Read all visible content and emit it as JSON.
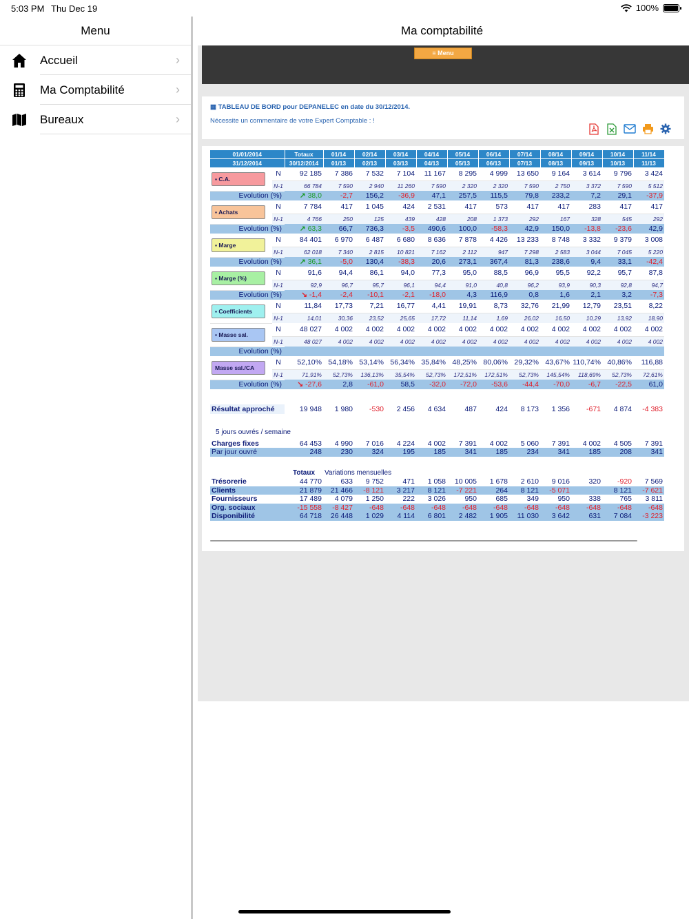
{
  "status": {
    "time": "5:03 PM",
    "date": "Thu Dec 19",
    "battery": "100%"
  },
  "sidebar": {
    "title": "Menu",
    "items": [
      {
        "label": "Accueil",
        "icon": "home-icon"
      },
      {
        "label": "Ma Comptabilité",
        "icon": "calculator-icon"
      },
      {
        "label": "Bureaux",
        "icon": "map-icon"
      }
    ]
  },
  "main": {
    "title": "Ma comptabilité",
    "menu_button": "≡ Menu",
    "heading": "TABLEAU DE BORD pour DEPANELEC en date du 30/12/2014.",
    "comment": "Nécessite un commentaire de votre Expert Comptable : !",
    "tools": [
      "pdf-icon",
      "excel-icon",
      "mail-icon",
      "print-icon",
      "settings-icon"
    ]
  },
  "table": {
    "head1": [
      "01/01/2014",
      "Totaux",
      "01/14",
      "02/14",
      "03/14",
      "04/14",
      "05/14",
      "06/14",
      "07/14",
      "08/14",
      "09/14",
      "10/14",
      "11/14"
    ],
    "head2": [
      "31/12/2014",
      "30/12/2014",
      "01/13",
      "02/13",
      "03/13",
      "04/13",
      "05/13",
      "06/13",
      "07/13",
      "08/13",
      "09/13",
      "10/13",
      "11/13"
    ],
    "blocks": [
      {
        "label": "C.A.",
        "color": "#f79a9e",
        "icon": "chart-line-icon",
        "n": [
          "92 185",
          "7 386",
          "7 532",
          "7 104",
          "11 167",
          "8 295",
          "4 999",
          "13 650",
          "9 164",
          "3 614",
          "9 796",
          "3 424"
        ],
        "n1": [
          "66 784",
          "7 590",
          "2 940",
          "11 260",
          "7 590",
          "2 320",
          "2 320",
          "7 590",
          "2 750",
          "3 372",
          "7 590",
          "5 512"
        ],
        "evo": [
          "38,0",
          "-2,7",
          "156,2",
          "-36,9",
          "47,1",
          "257,5",
          "115,5",
          "79,8",
          "233,2",
          "7,2",
          "29,1",
          "-37,9"
        ],
        "evo_dir": "up"
      },
      {
        "label": "Achats",
        "color": "#f8c49a",
        "icon": "briefcase-icon",
        "n": [
          "7 784",
          "417",
          "1 045",
          "424",
          "2 531",
          "417",
          "573",
          "417",
          "417",
          "283",
          "417",
          "417"
        ],
        "n1": [
          "4 766",
          "250",
          "125",
          "439",
          "428",
          "208",
          "1 373",
          "292",
          "167",
          "328",
          "545",
          "292"
        ],
        "evo": [
          "63,3",
          "66,7",
          "736,3",
          "-3,5",
          "490,6",
          "100,0",
          "-58,3",
          "42,9",
          "150,0",
          "-13,8",
          "-23,6",
          "42,9"
        ],
        "evo_dir": "up"
      },
      {
        "label": "Marge",
        "color": "#f1f29a",
        "icon": "area-chart-icon",
        "n": [
          "84 401",
          "6 970",
          "6 487",
          "6 680",
          "8 636",
          "7 878",
          "4 426",
          "13 233",
          "8 748",
          "3 332",
          "9 379",
          "3 008"
        ],
        "n1": [
          "62 018",
          "7 340",
          "2 815",
          "10 821",
          "7 162",
          "2 112",
          "947",
          "7 298",
          "2 583",
          "3 044",
          "7 045",
          "5 220"
        ],
        "evo": [
          "36,1",
          "-5,0",
          "130,4",
          "-38,3",
          "20,6",
          "273,1",
          "367,4",
          "81,3",
          "238,6",
          "9,4",
          "33,1",
          "-42,4"
        ],
        "evo_dir": "up"
      },
      {
        "label": "Marge (%)",
        "color": "#a8f0a3",
        "icon": "bar-chart-icon",
        "n": [
          "91,6",
          "94,4",
          "86,1",
          "94,0",
          "77,3",
          "95,0",
          "88,5",
          "96,9",
          "95,5",
          "92,2",
          "95,7",
          "87,8"
        ],
        "n1": [
          "92,9",
          "96,7",
          "95,7",
          "96,1",
          "94,4",
          "91,0",
          "40,8",
          "96,2",
          "93,9",
          "90,3",
          "92,8",
          "94,7"
        ],
        "evo": [
          "-1,4",
          "-2,4",
          "-10,1",
          "-2,1",
          "-18,0",
          "4,3",
          "116,9",
          "0,8",
          "1,6",
          "2,1",
          "3,2",
          "-7,3"
        ],
        "evo_dir": "down"
      },
      {
        "label": "Coefficients",
        "color": "#9ff0ef",
        "icon": "exchange-icon",
        "n": [
          "11,84",
          "17,73",
          "7,21",
          "16,77",
          "4,41",
          "19,91",
          "8,73",
          "32,76",
          "21,99",
          "12,79",
          "23,51",
          "8,22"
        ],
        "n1": [
          "14,01",
          "30,36",
          "23,52",
          "25,65",
          "17,72",
          "11,14",
          "1,69",
          "26,02",
          "16,50",
          "10,29",
          "13,92",
          "18,90"
        ],
        "evo": null
      },
      {
        "label": "Masse sal.",
        "color": "#a9c6f3",
        "icon": "users-icon",
        "n": [
          "48 027",
          "4 002",
          "4 002",
          "4 002",
          "4 002",
          "4 002",
          "4 002",
          "4 002",
          "4 002",
          "4 002",
          "4 002",
          "4 002"
        ],
        "n1": [
          "48 027",
          "4 002",
          "4 002",
          "4 002",
          "4 002",
          "4 002",
          "4 002",
          "4 002",
          "4 002",
          "4 002",
          "4 002",
          "4 002"
        ],
        "evo": [
          "",
          "",
          "",
          "",
          "",
          "",
          "",
          "",
          "",
          "",
          "",
          ""
        ],
        "evo_dir": "none"
      },
      {
        "label": "Masse sal./CA",
        "color": "#c2a8f2",
        "icon": "",
        "n": [
          "52,10%",
          "54,18%",
          "53,14%",
          "56,34%",
          "35,84%",
          "48,25%",
          "80,06%",
          "29,32%",
          "43,67%",
          "110,74%",
          "40,86%",
          "116,88"
        ],
        "n1": [
          "71,91%",
          "52,73%",
          "136,13%",
          "35,54%",
          "52,73%",
          "172,51%",
          "172,51%",
          "52,73%",
          "145,54%",
          "118,69%",
          "52,73%",
          "72,61%"
        ],
        "evo": [
          "-27,6",
          "2,8",
          "-61,0",
          "58,5",
          "-32,0",
          "-72,0",
          "-53,6",
          "-44,4",
          "-70,0",
          "-6,7",
          "-22,5",
          "61,0"
        ],
        "evo_dir": "down"
      }
    ],
    "n_label": "N",
    "n1_label": "N-1",
    "evo_label": "Evolution (%)",
    "resultat": {
      "label": "Résultat approché",
      "values": [
        "19 948",
        "1 980",
        "-530",
        "2 456",
        "4 634",
        "487",
        "424",
        "8 173",
        "1 356",
        "-671",
        "4 874",
        "-4 383"
      ]
    },
    "jours": "5 jours ouvrés / semaine",
    "charges": {
      "label": "Charges fixes",
      "values": [
        "64 453",
        "4 990",
        "7 016",
        "4 224",
        "4 002",
        "7 391",
        "4 002",
        "5 060",
        "7 391",
        "4 002",
        "4 505",
        "7 391"
      ]
    },
    "parjour": {
      "label": "Par jour ouvré",
      "values": [
        "248",
        "230",
        "324",
        "195",
        "185",
        "341",
        "185",
        "234",
        "341",
        "185",
        "208",
        "341"
      ]
    },
    "totaux_label": "Totaux",
    "variations_label": "Variations mensuelles",
    "tresorerie": [
      {
        "label": "Trésorerie",
        "values": [
          "44 770",
          "633",
          "9 752",
          "471",
          "1 058",
          "10 005",
          "1 678",
          "2 610",
          "9 016",
          "320",
          "-920",
          "7 569"
        ]
      },
      {
        "label": "Clients",
        "values": [
          "21 879",
          "21 466",
          "-8 121",
          "3 217",
          "8 121",
          "-7 221",
          "264",
          "8 121",
          "-5 071",
          "",
          "8 121",
          "-7 621"
        ]
      },
      {
        "label": "Fournisseurs",
        "values": [
          "17 489",
          "4 079",
          "1 250",
          "222",
          "3 026",
          "950",
          "685",
          "349",
          "950",
          "338",
          "765",
          "3 811"
        ]
      },
      {
        "label": "Org. sociaux",
        "values": [
          "-15 558",
          "-8 427",
          "-648",
          "-648",
          "-648",
          "-648",
          "-648",
          "-648",
          "-648",
          "-648",
          "-648",
          "-648"
        ]
      },
      {
        "label": "Disponibilité",
        "values": [
          "64 718",
          "26 448",
          "1 029",
          "4 114",
          "6 801",
          "2 482",
          "1 905",
          "11 030",
          "3 642",
          "631",
          "7 084",
          "-3 223"
        ]
      }
    ]
  }
}
